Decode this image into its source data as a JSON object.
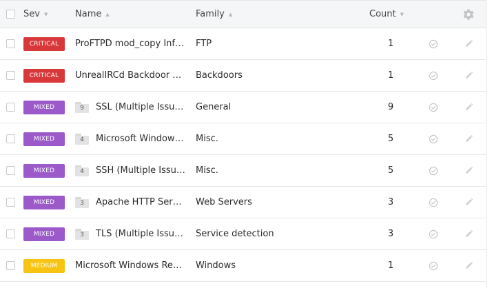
{
  "columns": {
    "sev": "Sev",
    "name": "Name",
    "family": "Family",
    "count": "Count"
  },
  "colors": {
    "critical": "#d9383a",
    "mixed": "#9b59c9",
    "medium": "#f7c413"
  },
  "icons": {
    "settings": "gear-icon",
    "status": "check-circle-icon",
    "edit": "pencil-icon",
    "group": "folder-icon"
  },
  "rows": [
    {
      "sev": "CRITICAL",
      "name": "ProFTPD mod_copy Infor...",
      "family": "FTP",
      "count": "1"
    },
    {
      "sev": "CRITICAL",
      "name": "UnrealIRCd Backdoor De...",
      "family": "Backdoors",
      "count": "1"
    },
    {
      "sev": "MIXED",
      "group_count": "9",
      "name": "SSL (Multiple Issues)",
      "family": "General",
      "count": "9"
    },
    {
      "sev": "MIXED",
      "group_count": "4",
      "name": "Microsoft Windows...",
      "family": "Misc.",
      "count": "5"
    },
    {
      "sev": "MIXED",
      "group_count": "4",
      "name": "SSH (Multiple Issues)",
      "family": "Misc.",
      "count": "5"
    },
    {
      "sev": "MIXED",
      "group_count": "3",
      "name": "Apache HTTP Serve...",
      "family": "Web Servers",
      "count": "3"
    },
    {
      "sev": "MIXED",
      "group_count": "3",
      "name": "TLS (Multiple Issues)",
      "family": "Service detection",
      "count": "3"
    },
    {
      "sev": "MEDIUM",
      "name": "Microsoft Windows Rem...",
      "family": "Windows",
      "count": "1"
    }
  ]
}
